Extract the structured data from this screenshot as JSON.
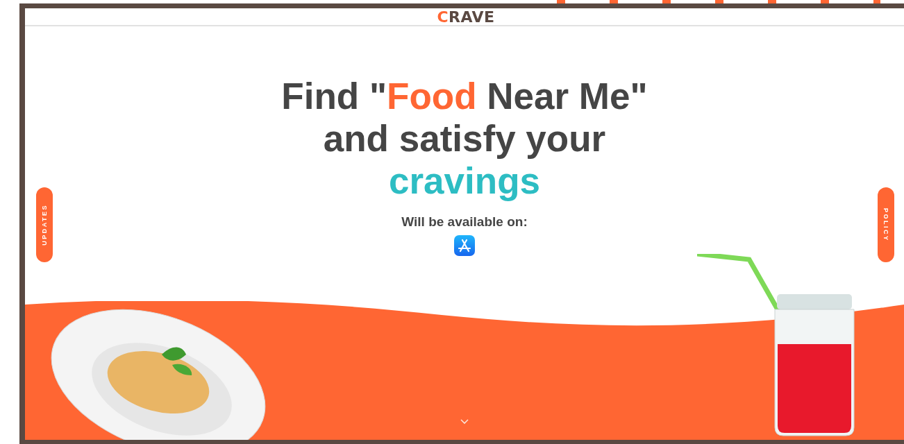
{
  "header": {
    "logo": "CRAVE"
  },
  "headline": {
    "lines": [
      [
        {
          "text": "Find \"",
          "kind": "plain"
        },
        {
          "text": "Food",
          "kind": "accent"
        },
        {
          "text": " Near Me\"",
          "kind": "plain"
        }
      ],
      [
        {
          "text": "and satisfy your",
          "kind": "plain"
        }
      ],
      [
        {
          "text": "cravings",
          "kind": "highlight"
        }
      ]
    ]
  },
  "availability": {
    "label": "Will be available on:"
  },
  "side_tabs": [
    {
      "label": "UPDATES",
      "kind": "left"
    },
    {
      "label": "POLICY",
      "kind": "right"
    }
  ]
}
